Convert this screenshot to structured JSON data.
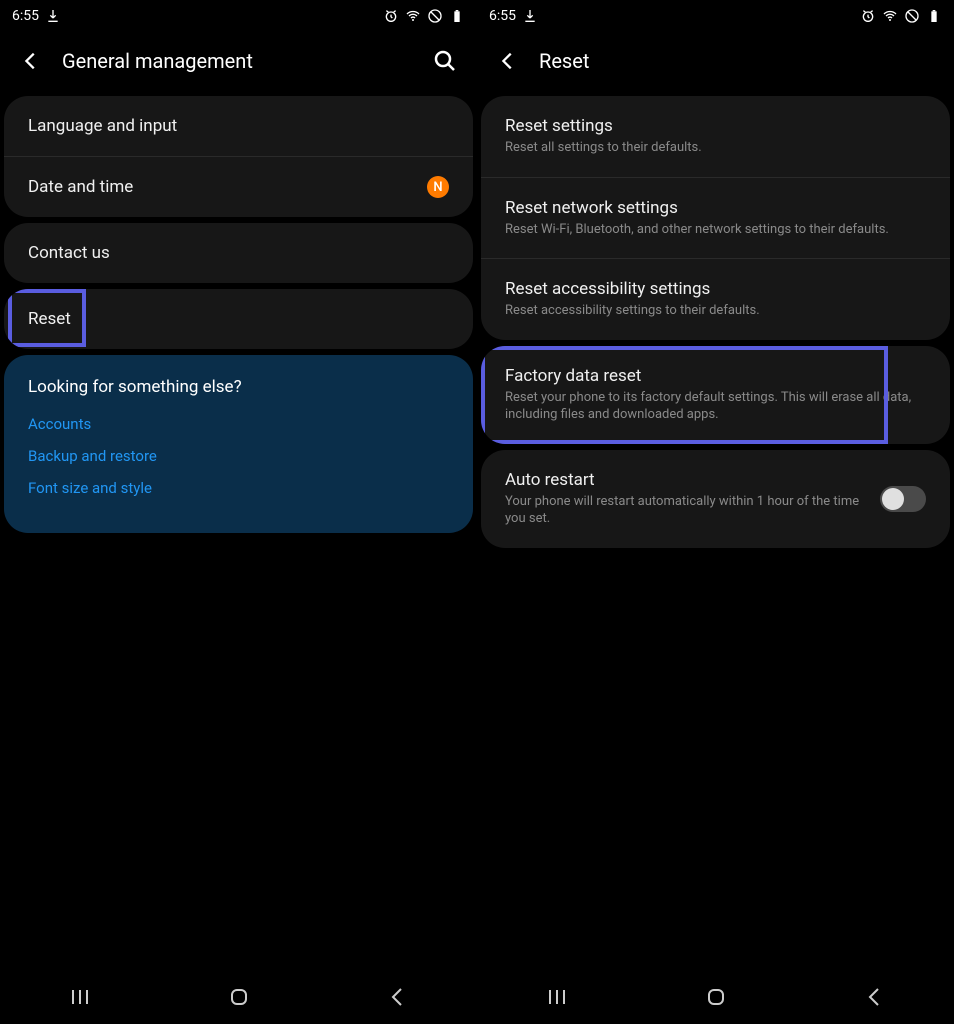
{
  "status": {
    "time": "6:55",
    "badge_n": "N"
  },
  "left": {
    "title": "General management",
    "items": {
      "language": "Language and input",
      "datetime": "Date and time",
      "contact": "Contact us",
      "reset": "Reset"
    },
    "looking": {
      "title": "Looking for something else?",
      "links": {
        "accounts": "Accounts",
        "backup": "Backup and restore",
        "font": "Font size and style"
      }
    }
  },
  "right": {
    "title": "Reset",
    "items": {
      "reset_settings": {
        "title": "Reset settings",
        "sub": "Reset all settings to their defaults."
      },
      "reset_network": {
        "title": "Reset network settings",
        "sub": "Reset Wi-Fi, Bluetooth, and other network settings to their defaults."
      },
      "reset_access": {
        "title": "Reset accessibility settings",
        "sub": "Reset accessibility settings to their defaults."
      },
      "factory": {
        "title": "Factory data reset",
        "sub": "Reset your phone to its factory default settings. This will erase all data, including files and downloaded apps."
      },
      "auto_restart": {
        "title": "Auto restart",
        "sub": "Your phone will restart automatically within 1 hour of the time you set."
      }
    }
  }
}
